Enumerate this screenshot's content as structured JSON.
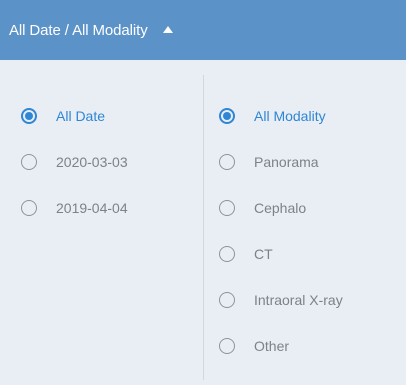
{
  "header": {
    "title": "All Date / All Modality",
    "caret_icon": "caret-up-icon"
  },
  "date_filter": {
    "selected": "All Date",
    "options": [
      {
        "label": "All Date",
        "checked": true
      },
      {
        "label": "2020-03-03",
        "checked": false
      },
      {
        "label": "2019-04-04",
        "checked": false
      }
    ]
  },
  "modality_filter": {
    "selected": "All Modality",
    "options": [
      {
        "label": "All Modality",
        "checked": true
      },
      {
        "label": "Panorama",
        "checked": false
      },
      {
        "label": "Cephalo",
        "checked": false
      },
      {
        "label": "CT",
        "checked": false
      },
      {
        "label": "Intraoral X-ray",
        "checked": false
      },
      {
        "label": "Other",
        "checked": false
      }
    ]
  },
  "colors": {
    "header_bg": "#5b92c8",
    "panel_bg": "#e8eef3",
    "accent": "#2f86d6",
    "text_muted": "#7c8287"
  }
}
